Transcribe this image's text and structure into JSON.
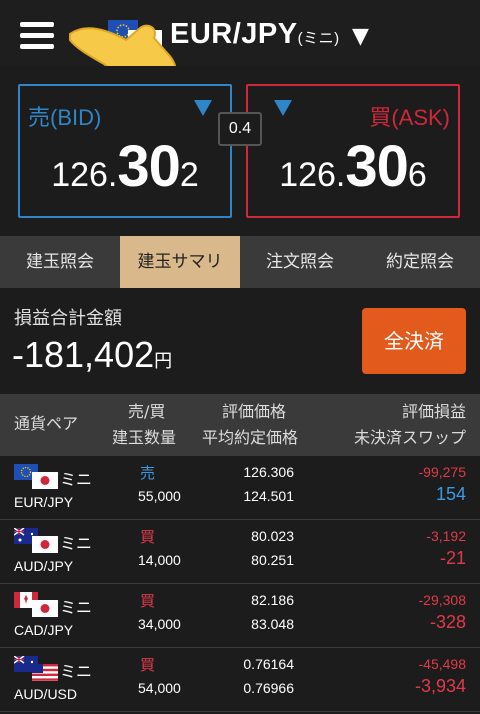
{
  "header": {
    "pair": "EUR/JPY",
    "pair_sub": "(ミニ)",
    "caret": "▼"
  },
  "bid": {
    "label": "売(BID)",
    "price_prefix": "126.",
    "price_big": "30",
    "price_last": "2"
  },
  "ask": {
    "label": "買(ASK)",
    "price_prefix": "126.",
    "price_big": "30",
    "price_last": "6"
  },
  "spread": "0.4",
  "tabs": [
    {
      "label": "建玉照会",
      "active": false
    },
    {
      "label": "建玉サマリ",
      "active": true
    },
    {
      "label": "注文照会",
      "active": false
    },
    {
      "label": "約定照会",
      "active": false
    }
  ],
  "summary": {
    "label": "損益合計金額",
    "value": "-181,402",
    "unit": "円",
    "close_all": "全決済"
  },
  "columns": {
    "pair": "通貨ペア",
    "side": "売/買",
    "qty": "建玉数量",
    "eval_price": "評価価格",
    "avg_price": "平均約定価格",
    "eval_pl": "評価損益",
    "swap": "未決済スワップ"
  },
  "rows": [
    {
      "mini": "ミニ",
      "pair": "EUR/JPY",
      "side": "売",
      "side_type": "sell",
      "qty": "55,000",
      "current": "126.306",
      "average": "124.501",
      "pl": "-99,275",
      "swap": "154",
      "swap_type": "sell"
    },
    {
      "mini": "ミニ",
      "pair": "AUD/JPY",
      "side": "買",
      "side_type": "buy",
      "qty": "14,000",
      "current": "80.023",
      "average": "80.251",
      "pl": "-3,192",
      "swap": "-21",
      "swap_type": "buy"
    },
    {
      "mini": "ミニ",
      "pair": "CAD/JPY",
      "side": "買",
      "side_type": "buy",
      "qty": "34,000",
      "current": "82.186",
      "average": "83.048",
      "pl": "-29,308",
      "swap": "-328",
      "swap_type": "buy"
    },
    {
      "mini": "ミニ",
      "pair": "AUD/USD",
      "side": "買",
      "side_type": "buy",
      "qty": "54,000",
      "current": "0.76164",
      "average": "0.76966",
      "pl": "-45,498",
      "swap": "-3,934",
      "swap_type": "buy"
    }
  ],
  "colors": {
    "bid": "#2e86c9",
    "ask": "#d0283a",
    "active_tab": "#d9b98b",
    "close_all": "#e25b1d",
    "loss": "#e03a4a",
    "gain": "#3b9be0"
  },
  "icons": {
    "menu": "hamburger-menu-icon",
    "pointer": "pointing-hand-icon",
    "pair_flags": "eu-japan-flags-icon"
  }
}
